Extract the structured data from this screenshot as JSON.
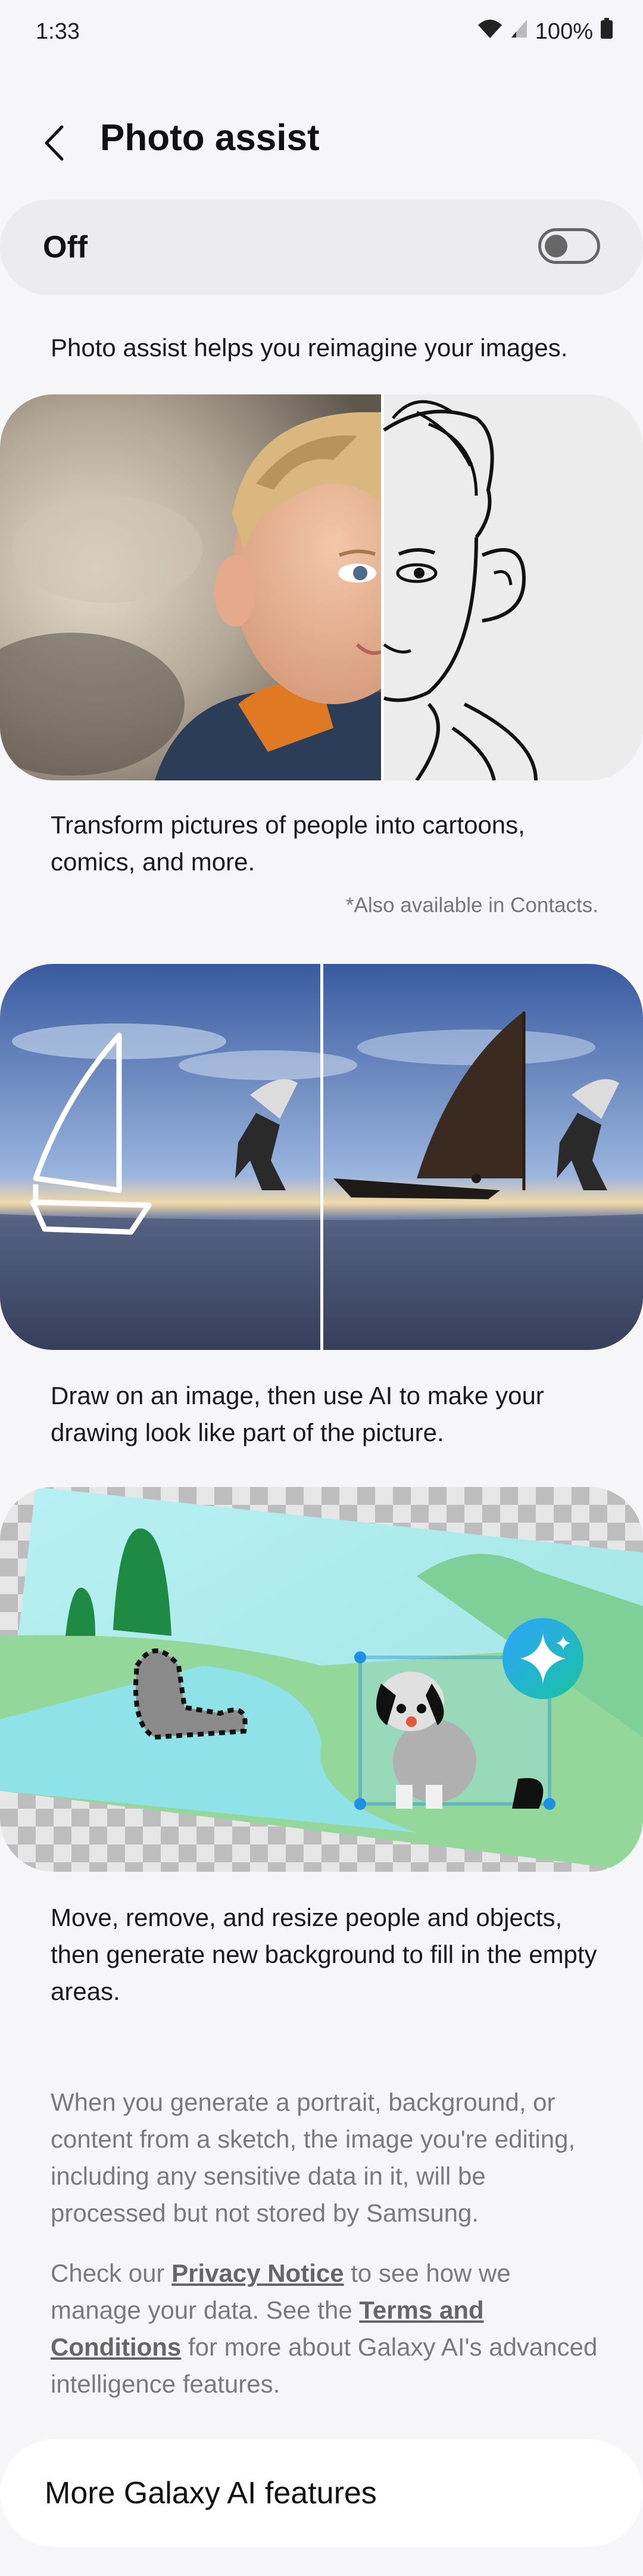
{
  "status": {
    "time": "1:33",
    "battery": "100%"
  },
  "header": {
    "title": "Photo assist"
  },
  "master_switch": {
    "label": "Off",
    "state": false
  },
  "intro": "Photo assist helps you reimagine your images.",
  "feature_portrait": {
    "desc": "Transform pictures of people into cartoons, comics, and more.",
    "note": "*Also available in Contacts."
  },
  "feature_sketch": {
    "desc": "Draw on an image, then use AI to make your drawing look like part of the picture."
  },
  "feature_move": {
    "desc": "Move, remove, and resize people and objects, then generate new background to fill in the empty areas."
  },
  "privacy": {
    "para1": "When you generate a portrait, background, or content from a sketch, the image you're editing, including any sensitive data in it, will be processed but not stored by Samsung.",
    "para2_prefix": "Check our ",
    "privacy_link": "Privacy Notice",
    "para2_mid": " to see how we manage your data. See the ",
    "terms_link": "Terms and Conditions",
    "para2_suffix": " for more about Galaxy AI's advanced intelligence features."
  },
  "more_button": {
    "label": "More Galaxy AI features"
  },
  "colors": {
    "accent": "#1e8fe6",
    "link": "#666666"
  }
}
